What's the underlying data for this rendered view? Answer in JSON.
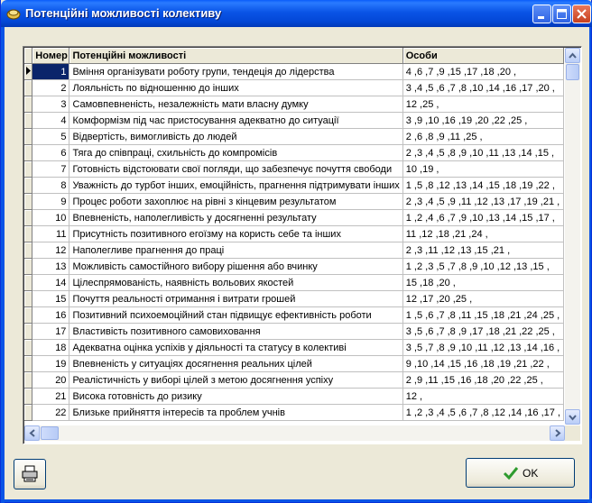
{
  "window": {
    "title": "Потенційні можливості колективу"
  },
  "grid": {
    "columns": [
      "Номер",
      "Потенційні можливості",
      "Особи"
    ],
    "rows": [
      {
        "num": "1",
        "text": "Вміння організувати роботу групи, тендеція до лідерства",
        "persons": "4 ,6 ,7 ,9 ,15 ,17 ,18 ,20 ,"
      },
      {
        "num": "2",
        "text": "Лояльність по відношенню до інших",
        "persons": "3 ,4 ,5 ,6 ,7 ,8 ,10 ,14 ,16 ,17 ,20 ,"
      },
      {
        "num": "3",
        "text": "Самовпевненість, незалежність мати власну думку",
        "persons": "12 ,25 ,"
      },
      {
        "num": "4",
        "text": "Комформізм під час пристосування адекватно до ситуації",
        "persons": "3 ,9 ,10 ,16 ,19 ,20 ,22 ,25 ,"
      },
      {
        "num": "5",
        "text": "Відвертість, вимогливість до людей",
        "persons": "2 ,6 ,8 ,9 ,11 ,25 ,"
      },
      {
        "num": "6",
        "text": "Тяга до співпраці, схильність до компромісів",
        "persons": "2 ,3 ,4 ,5 ,8 ,9 ,10 ,11 ,13 ,14 ,15 ,"
      },
      {
        "num": "7",
        "text": "Готовність відстоювати свої погляди, що забезпечує почуття свободи",
        "persons": "10 ,19 ,"
      },
      {
        "num": "8",
        "text": "Уважність до турбот інших, емоційність, прагнення підтримувати інших",
        "persons": "1 ,5 ,8 ,12 ,13 ,14 ,15 ,18 ,19 ,22 ,"
      },
      {
        "num": "9",
        "text": "Процес роботи захоплює на рівні з кінцевим результатом",
        "persons": "2 ,3 ,4 ,5 ,9 ,11 ,12 ,13 ,17 ,19 ,21 ,"
      },
      {
        "num": "10",
        "text": "Впевненість, наполегливість у досягненні результату",
        "persons": "1 ,2 ,4 ,6 ,7 ,9 ,10 ,13 ,14 ,15 ,17 ,"
      },
      {
        "num": "11",
        "text": "Присутність позитивного егоїзму на користь себе та інших",
        "persons": "11 ,12 ,18 ,21 ,24 ,"
      },
      {
        "num": "12",
        "text": "Наполегливе прагнення до праці",
        "persons": "2 ,3 ,11 ,12 ,13 ,15 ,21 ,"
      },
      {
        "num": "13",
        "text": "Можливість самостійного вибору рішення або вчинку",
        "persons": "1 ,2 ,3 ,5 ,7 ,8 ,9 ,10 ,12 ,13 ,15 ,"
      },
      {
        "num": "14",
        "text": "Цілеспрямованість, наявність вольових якостей",
        "persons": "15 ,18 ,20 ,"
      },
      {
        "num": "15",
        "text": "Почуття реальності отримання і витрати грошей",
        "persons": "12 ,17 ,20 ,25 ,"
      },
      {
        "num": "16",
        "text": "Позитивний психоемоційний стан підвищує ефективність роботи",
        "persons": "1 ,5 ,6 ,7 ,8 ,11 ,15 ,18 ,21 ,24 ,25 ,"
      },
      {
        "num": "17",
        "text": "Властивість позитивного самовиховання",
        "persons": "3 ,5 ,6 ,7 ,8 ,9 ,17 ,18 ,21 ,22 ,25 ,"
      },
      {
        "num": "18",
        "text": "Адекватна оцінка успіхів у діяльності та статусу в колективі",
        "persons": "3 ,5 ,7 ,8 ,9 ,10 ,11 ,12 ,13 ,14 ,16 ,"
      },
      {
        "num": "19",
        "text": "Впевненість у ситуаціях досягнення реальних цілей",
        "persons": "9 ,10 ,14 ,15 ,16 ,18 ,19 ,21 ,22 ,"
      },
      {
        "num": "20",
        "text": "Реалістичність у виборі цілей з метою досягнення успіху",
        "persons": "2 ,9 ,11 ,15 ,16 ,18 ,20 ,22 ,25 ,"
      },
      {
        "num": "21",
        "text": "Висока готовність до ризику",
        "persons": "12 ,"
      },
      {
        "num": "22",
        "text": "Близьке прийняття інтересів та проблем учнів",
        "persons": "1 ,2 ,3 ,4 ,5 ,6 ,7 ,8 ,12 ,14 ,16 ,17 ,"
      }
    ]
  },
  "buttons": {
    "ok_label": "OK"
  },
  "icons": {
    "title": "app-icon",
    "print": "printer-icon",
    "ok": "checkmark-icon"
  },
  "colors": {
    "title_bar": "#0a54e6",
    "selection": "#0a246a",
    "ok_check": "#2e9b2e"
  }
}
